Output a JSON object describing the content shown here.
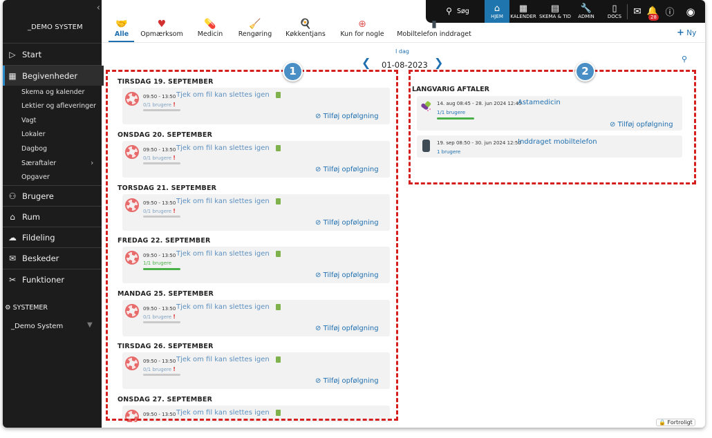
{
  "sidebar": {
    "system_title": "_DEMO SYSTEM",
    "main_items": [
      {
        "label": "Start",
        "icon": "play-icon"
      },
      {
        "label": "Begivenheder",
        "icon": "calendar-icon"
      },
      {
        "label": "Brugere",
        "icon": "users-icon"
      },
      {
        "label": "Rum",
        "icon": "building-icon"
      },
      {
        "label": "Fildeling",
        "icon": "cloud-icon"
      },
      {
        "label": "Beskeder",
        "icon": "chat-icon"
      },
      {
        "label": "Funktioner",
        "icon": "tools-icon"
      }
    ],
    "sub_items": [
      "Skema og kalender",
      "Lektier og afleveringer",
      "Vagt",
      "Lokaler",
      "Dagbog",
      "Særaftaler",
      "Opgaver"
    ],
    "systems_label": "SYSTEMER",
    "current_system": "_Demo System"
  },
  "topbar": {
    "search_label": "Søg",
    "items": [
      "HJEM",
      "KALENDER",
      "SKEMA & TID",
      "ADMIN",
      "DOCS"
    ],
    "notification_count": "28"
  },
  "categories": [
    "Alle",
    "Opmærksom",
    "Medicin",
    "Rengøring",
    "Køkkentjans",
    "Kun for nogle",
    "Mobiltelefon inddraget"
  ],
  "new_button": "Ny",
  "date_nav": {
    "today_label": "I dag",
    "date": "01-08-2023"
  },
  "days": [
    {
      "title": "TIRSDAG 19. SEPTEMBER",
      "time": "09:50 - 13:50",
      "event": "Tjek om fil kan slettes igen",
      "users": "0/1 brugere",
      "complete": false,
      "follow": "Tilføj opfølgning"
    },
    {
      "title": "ONSDAG 20. SEPTEMBER",
      "time": "09:50 - 13:50",
      "event": "Tjek om fil kan slettes igen",
      "users": "0/1 brugere",
      "complete": false,
      "follow": "Tilføj opfølgning"
    },
    {
      "title": "TORSDAG 21. SEPTEMBER",
      "time": "09:50 - 13:50",
      "event": "Tjek om fil kan slettes igen",
      "users": "0/1 brugere",
      "complete": false,
      "follow": "Tilføj opfølgning"
    },
    {
      "title": "FREDAG 22. SEPTEMBER",
      "time": "09:50 - 13:50",
      "event": "Tjek om fil kan slettes igen",
      "users": "1/1 brugere",
      "complete": true,
      "follow": "Tilføj opfølgning"
    },
    {
      "title": "MANDAG 25. SEPTEMBER",
      "time": "09:50 - 13:50",
      "event": "Tjek om fil kan slettes igen",
      "users": "0/1 brugere",
      "complete": false,
      "follow": "Tilføj opfølgning"
    },
    {
      "title": "TIRSDAG 26. SEPTEMBER",
      "time": "09:50 - 13:50",
      "event": "Tjek om fil kan slettes igen",
      "users": "0/1 brugere",
      "complete": false,
      "follow": "Tilføj opfølgning"
    },
    {
      "title": "ONSDAG 27. SEPTEMBER",
      "time": "09:50 - 13:50",
      "event": "Tjek om fil kan slettes igen",
      "users": "",
      "complete": false,
      "follow": ""
    }
  ],
  "long_term": {
    "title": "LANGVARIG AFTALER",
    "items": [
      {
        "time": "14. aug 08:45 - 28. jun 2024 12:45",
        "event": "Astamedicin",
        "users": "1/1 brugere",
        "follow": "Tilføj opfølgning",
        "icon": "medicine-icon"
      },
      {
        "time": "19. sep 08:50 - 30. jun 2024 12:50",
        "event": "Inddraget mobiltelefon",
        "users": "1 brugere",
        "follow": "",
        "icon": "phone-icon"
      }
    ]
  },
  "annotations": [
    "1",
    "2"
  ],
  "confidential_label": "Fortroligt",
  "colors": {
    "accent": "#1f6fb0",
    "highlight": "#d51f1f",
    "sidebar": "#1c1c1c",
    "success": "#49b047"
  }
}
